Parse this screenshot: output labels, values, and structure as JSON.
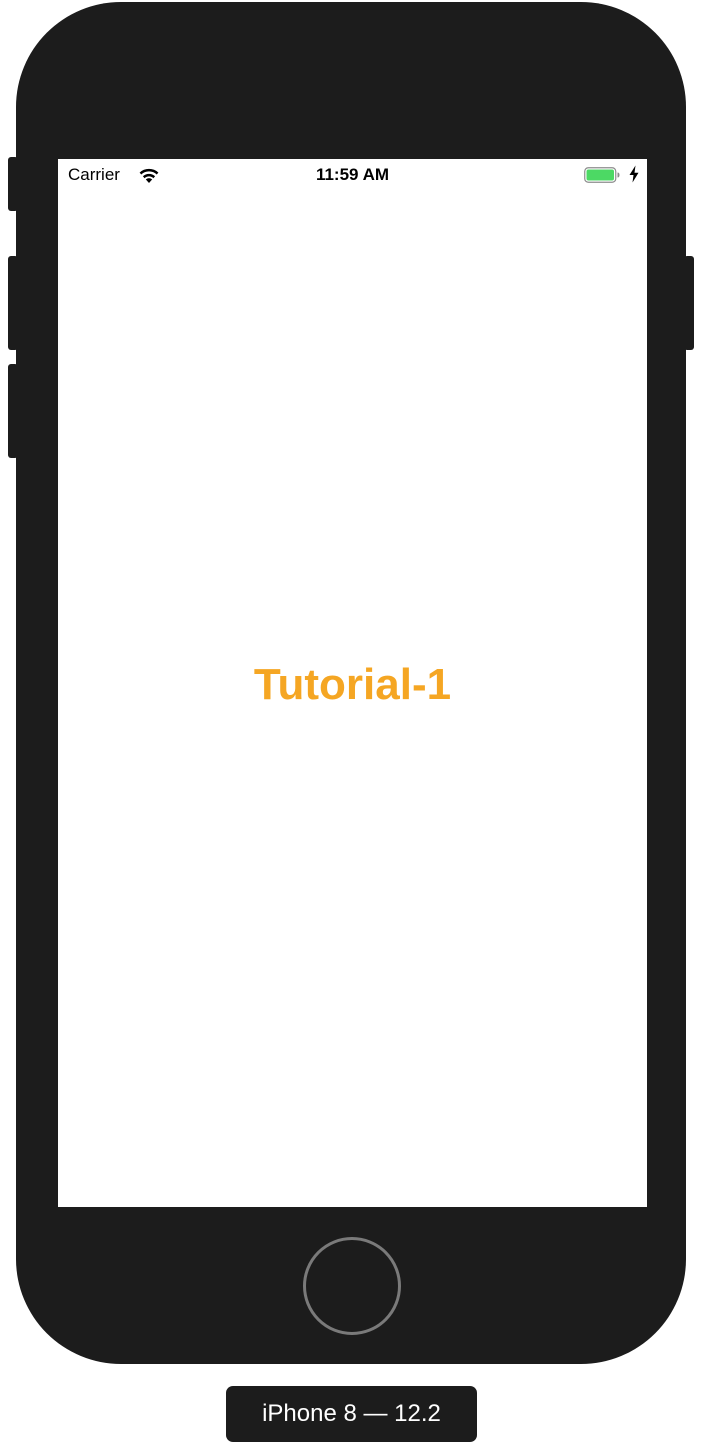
{
  "status_bar": {
    "carrier": "Carrier",
    "time": "11:59 AM",
    "wifi_icon": "wifi-icon",
    "battery_icon": "battery-icon",
    "charging_icon": "lightning-bolt-icon",
    "battery_color": "#4cd964"
  },
  "screen": {
    "title": "Tutorial-1",
    "title_color": "#f5a623",
    "background": "#ffffff"
  },
  "device": {
    "label": "iPhone 8 — 12.2",
    "frame_color": "#1c1c1c"
  }
}
